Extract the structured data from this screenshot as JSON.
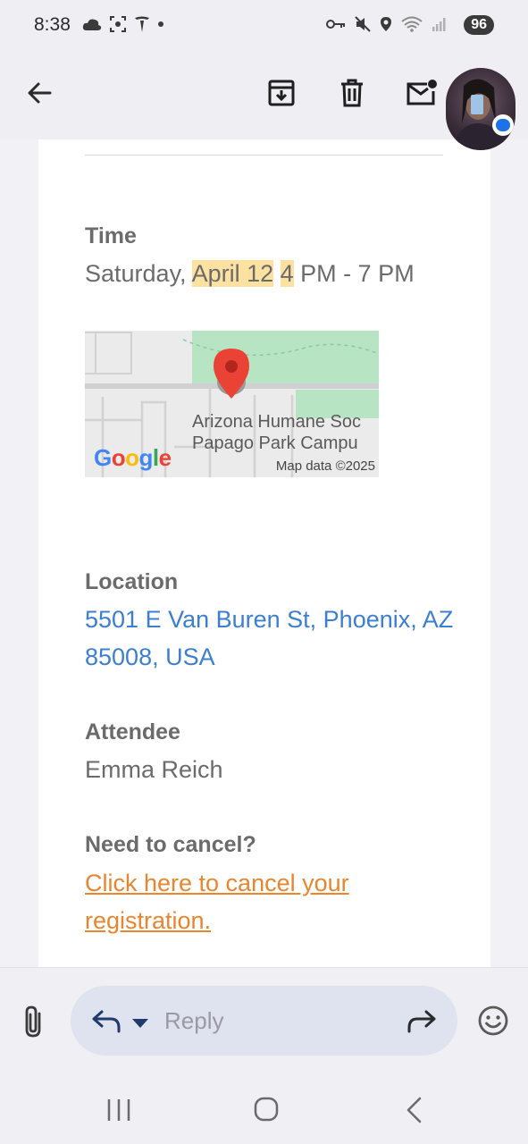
{
  "status": {
    "time": "8:38",
    "battery": "96"
  },
  "email": {
    "time_label": "Time",
    "time_prefix": "Saturday, ",
    "time_highlight_1": "April 12",
    "time_highlight_2": "4",
    "time_suffix": " PM - 7 PM",
    "map": {
      "place_line1": "Arizona Humane Soc",
      "place_line2": "Papago Park Campu",
      "copyright": "Map data ©2025",
      "logo": "Google"
    },
    "location_label": "Location",
    "location_value": "5501 E Van Buren St, Phoenix, AZ 85008, USA",
    "attendee_label": "Attendee",
    "attendee_value": "Emma Reich",
    "cancel_label": "Need to cancel?",
    "cancel_link": "Click here to cancel your registration."
  },
  "reply_bar": {
    "placeholder": "Reply"
  },
  "colors": {
    "link_blue": "#3c7fd0",
    "link_orange": "#e8852f",
    "highlight": "#fce1a0",
    "map_green": "#b7e4c2",
    "pin_red": "#ea4335"
  },
  "icons": [
    "back-arrow-icon",
    "archive-icon",
    "trash-icon",
    "mark-unread-icon",
    "attachment-icon",
    "reply-icon",
    "dropdown-icon",
    "forward-icon",
    "emoji-icon",
    "recents-nav-icon",
    "home-nav-icon",
    "back-nav-icon"
  ]
}
